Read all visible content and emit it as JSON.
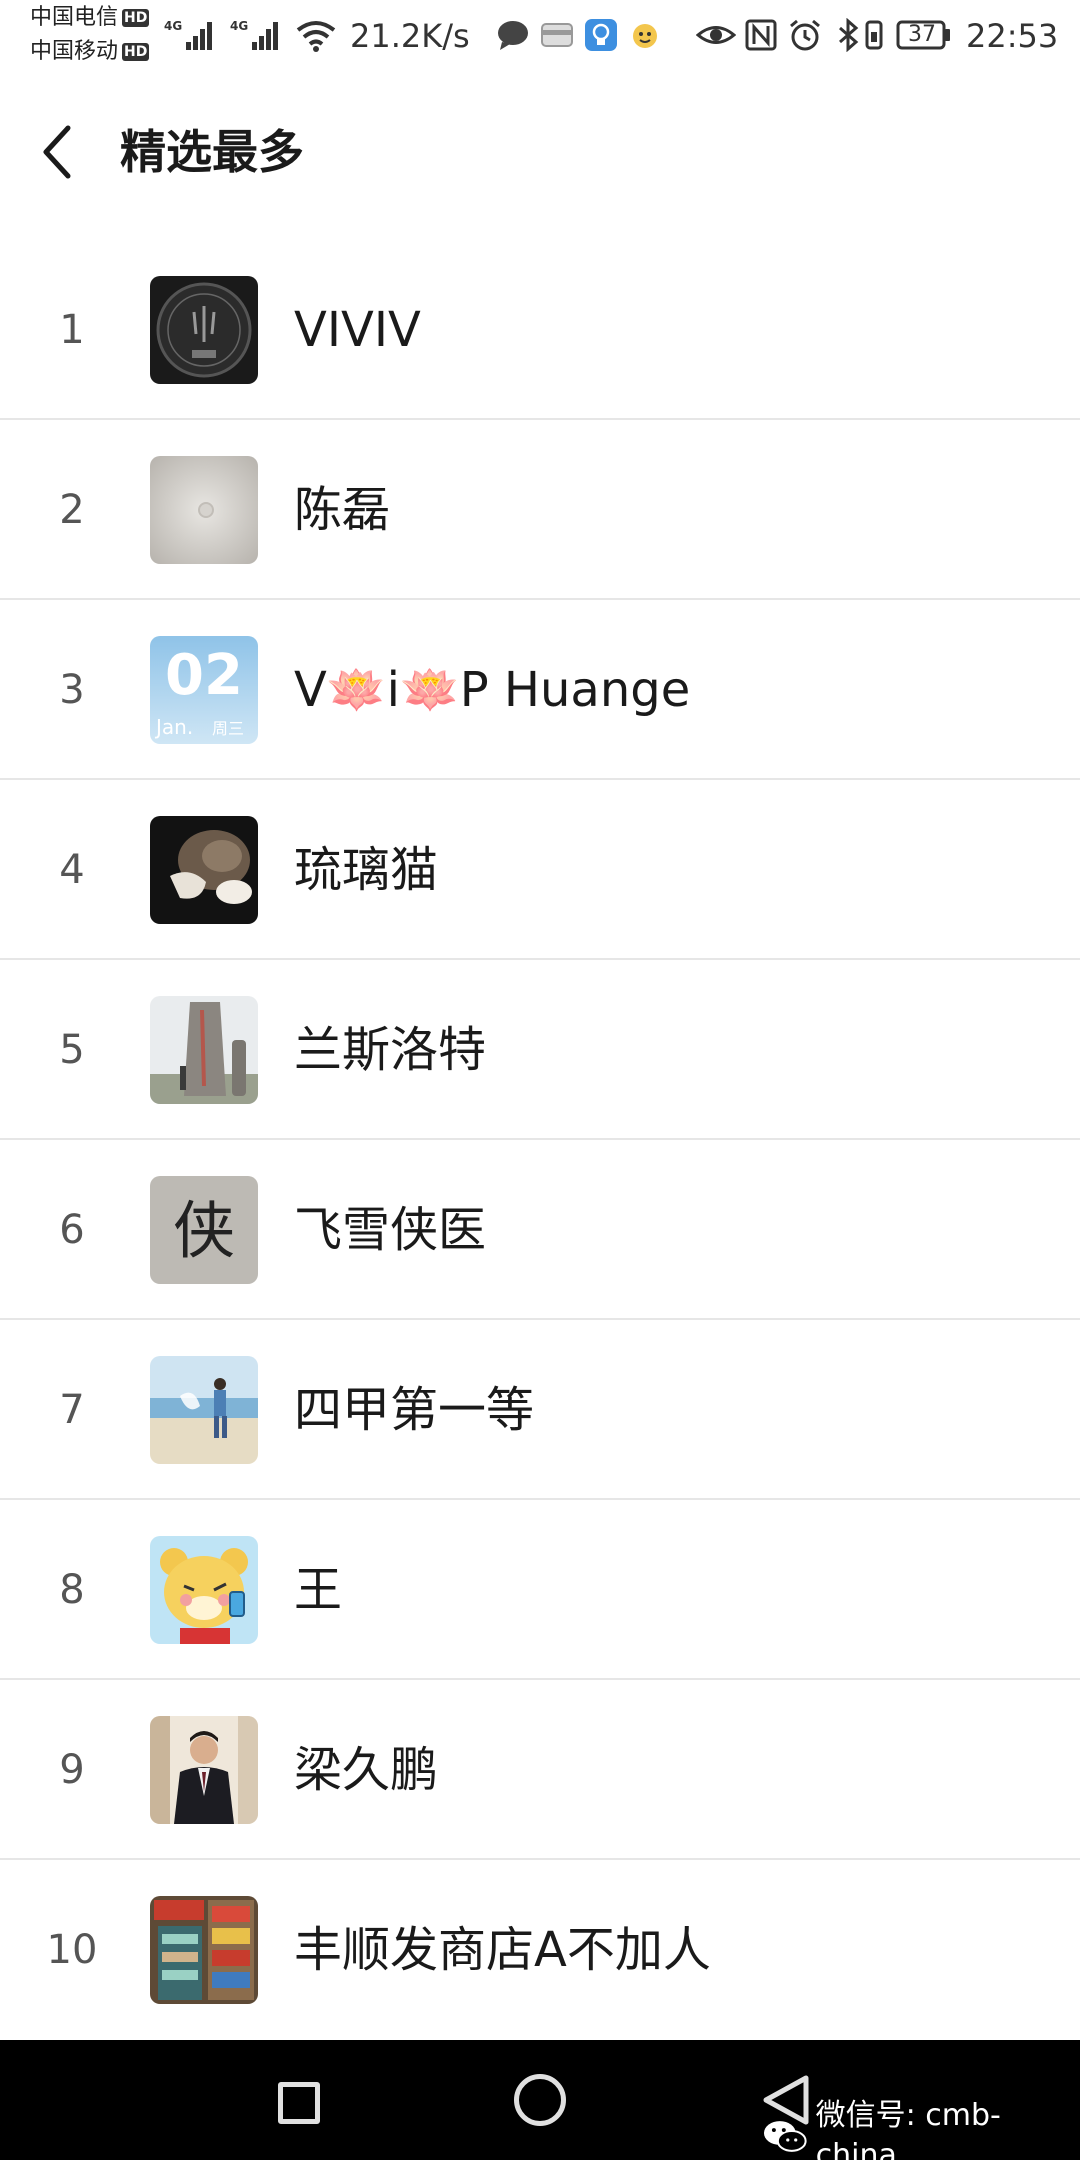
{
  "status_bar": {
    "carrier_1": "中国电信",
    "carrier_2": "中国移动",
    "hd_label": "HD",
    "network_1": "4G",
    "network_2": "4G",
    "speed": "21.2K/s",
    "battery": "37",
    "time": "22:53"
  },
  "header": {
    "title": "精选最多"
  },
  "list": [
    {
      "rank": "1",
      "name": "VIVIV",
      "avatar": "maserati-coin-avatar"
    },
    {
      "rank": "2",
      "name": "陈磊",
      "avatar": "blurred-gray-avatar"
    },
    {
      "rank": "3",
      "name": "V🪷i🪷P Huange",
      "avatar": "calendar-avatar",
      "avatar_text": {
        "day": "02",
        "month": "Jan.",
        "weekday": "周三"
      }
    },
    {
      "rank": "4",
      "name": "琉璃猫",
      "avatar": "cat-photo-avatar"
    },
    {
      "rank": "5",
      "name": "兰斯洛特",
      "avatar": "stone-monument-avatar"
    },
    {
      "rank": "6",
      "name": "飞雪侠医",
      "avatar": "calligraphy-avatar",
      "avatar_text": {
        "char": "侠"
      }
    },
    {
      "rank": "7",
      "name": "四甲第一等",
      "avatar": "beach-photo-avatar"
    },
    {
      "rank": "8",
      "name": "王",
      "avatar": "cartoon-bear-avatar"
    },
    {
      "rank": "9",
      "name": "梁久鹏",
      "avatar": "man-in-suit-avatar"
    },
    {
      "rank": "10",
      "name": "丰顺发商店A不加人",
      "avatar": "shop-shelves-avatar"
    }
  ],
  "watermark": {
    "text": "微信号: cmb-china"
  },
  "colors": {
    "background": "#ffffff",
    "divider": "#e6e6e6",
    "nav_bar": "#000000",
    "text": "#1a1a1a",
    "rank_text": "#555555"
  }
}
